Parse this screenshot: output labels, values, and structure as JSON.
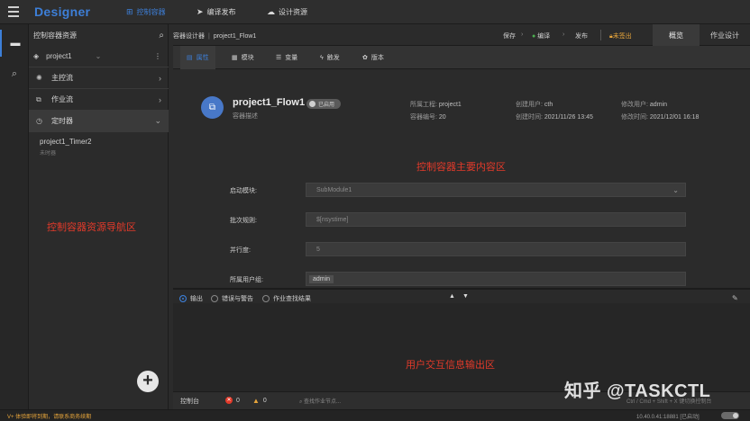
{
  "app": {
    "brand": "Designer",
    "nav": [
      {
        "label": "控制容器",
        "icon": "flow-icon"
      },
      {
        "label": "编译发布",
        "icon": "send-icon"
      },
      {
        "label": "设计资源",
        "icon": "cloud-icon"
      }
    ]
  },
  "sidebar": {
    "title": "控制容器资源",
    "project": "project1",
    "items": [
      {
        "label": "主控流",
        "icon": "gear-icon"
      },
      {
        "label": "作业流",
        "icon": "workflow-icon"
      },
      {
        "label": "定时器",
        "icon": "clock-icon"
      }
    ],
    "timer_child": "project1_Timer2",
    "timer_child_sub": "未时器",
    "annotation": "控制容器资源导航区"
  },
  "header": {
    "breadcrumb": [
      "容器设计器",
      "project1_Flow1"
    ],
    "actions": {
      "save": "保存",
      "compile": "编译",
      "publish": "发布",
      "unsigned": "未签出"
    },
    "tabs": [
      "概览",
      "作业设计"
    ]
  },
  "subtabs": [
    {
      "label": "属性",
      "icon": "document-icon"
    },
    {
      "label": "模块",
      "icon": "grid-icon"
    },
    {
      "label": "变量",
      "icon": "sliders-icon"
    },
    {
      "label": "触发",
      "icon": "bolt-icon"
    },
    {
      "label": "版本",
      "icon": "paw-icon"
    }
  ],
  "flow": {
    "name": "project1_Flow1",
    "toggle_label": "已启用",
    "description": "容器描述",
    "meta": {
      "project_label": "所属工程:",
      "project": "project1",
      "creator_label": "创建用户:",
      "creator": "cth",
      "modifier_label": "修改用户:",
      "modifier": "admin",
      "number_label": "容器编号:",
      "number": "20",
      "created_label": "创建时间:",
      "created": "2021/11/26 13:45",
      "modified_label": "修改时间:",
      "modified": "2021/12/01 16:18"
    },
    "annotation": "控制容器主要内容区"
  },
  "form": {
    "start_module_label": "启动模块:",
    "start_module_value": "SubModule1",
    "batch_rule_label": "批次规则:",
    "batch_rule_value": "$[nsystime]",
    "parallel_label": "并行度:",
    "parallel_value": "5",
    "user_group_label": "所属用户组:",
    "user_group_value": "admin"
  },
  "output": {
    "tabs": [
      "输出",
      "错误与警告",
      "作业查找结果"
    ],
    "annotation": "用户交互信息输出区"
  },
  "console": {
    "label": "控制台",
    "errors": "0",
    "warnings": "0",
    "search_placeholder": "查找作业节点...",
    "shortcut": "Ctrl / Cmd + Shift + X 键切换控制台"
  },
  "status": {
    "license": "V+ 体验即将到期，请联系商务续期",
    "server": "10.40.0.41:18881 [已启动]"
  },
  "watermark": "知乎 @TASKCTL"
}
